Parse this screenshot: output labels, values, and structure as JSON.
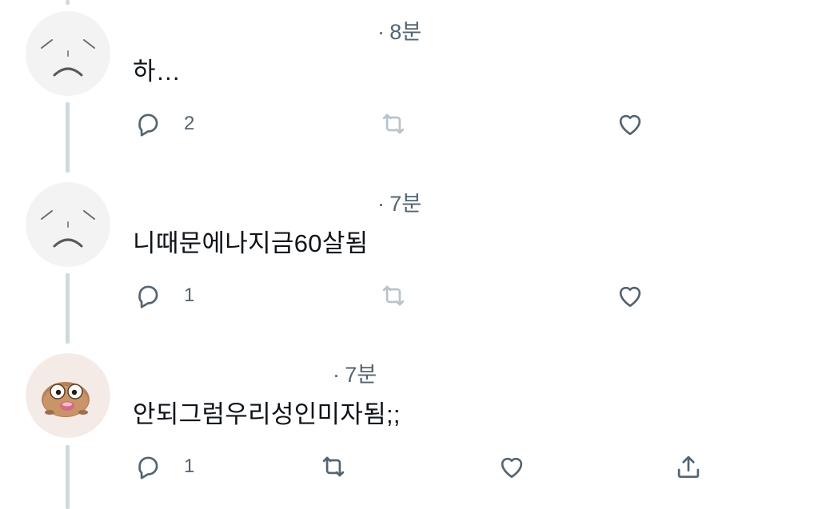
{
  "tweets": [
    {
      "time": "8분",
      "dot": "·",
      "text": "하…",
      "reply_count": "2"
    },
    {
      "time": "7분",
      "dot": "·",
      "text": "니때문에나지금60살됨",
      "reply_count": "1"
    },
    {
      "time": "7분",
      "dot": "·",
      "text": "안되그럼우리성인미자됨;;",
      "reply_count": "1"
    }
  ],
  "colors": {
    "text_primary": "#0f1419",
    "text_secondary": "#536471",
    "thread_line": "#cfd9de",
    "retweet_muted": "#b8c3cb"
  },
  "icons": [
    "reply-icon",
    "retweet-icon",
    "like-icon",
    "share-icon",
    "sad-face-avatar",
    "character-avatar"
  ]
}
